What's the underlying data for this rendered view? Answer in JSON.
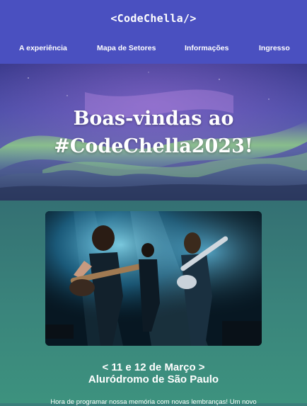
{
  "header": {
    "logo": "<CodeChella/>",
    "nav": [
      {
        "label": "A experiência"
      },
      {
        "label": "Mapa de Setores"
      },
      {
        "label": "Informações"
      },
      {
        "label": "Ingresso"
      }
    ]
  },
  "hero": {
    "title_line1": "Boas-vindas ao",
    "title_line2": "#CodeChella2023!"
  },
  "event": {
    "date": "< 11 e 12 de Março >",
    "venue": "Aluródromo de São Paulo",
    "description": "Hora de programar nossa memória com novas lembranças! Um novo"
  },
  "colors": {
    "header_bg": "#4a50c0",
    "main_bg": "#3a857c",
    "text": "#ffffff"
  }
}
